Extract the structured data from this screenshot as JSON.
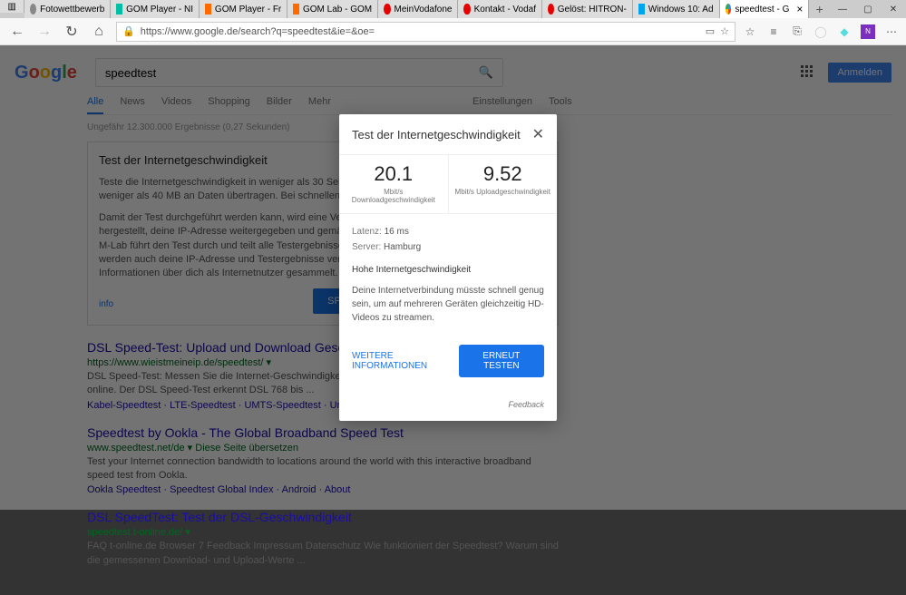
{
  "browser": {
    "tabs": [
      {
        "label": "Fotowettbewerb",
        "color": "#888"
      },
      {
        "label": "GOM Player - NI",
        "color": "#00bfa5"
      },
      {
        "label": "GOM Player - Fr",
        "color": "#ff6a00"
      },
      {
        "label": "GOM Lab - GOM",
        "color": "#ff6a00"
      },
      {
        "label": "MeinVodafone",
        "color": "#e60000"
      },
      {
        "label": "Kontakt - Vodaf",
        "color": "#e60000"
      },
      {
        "label": "Gelöst: HITRON-",
        "color": "#e60000"
      },
      {
        "label": "Windows 10: Ad",
        "color": "#00a4ef"
      },
      {
        "label": "speedtest - G",
        "color": "#4285f4",
        "active": true
      }
    ],
    "url": "https://www.google.de/search?q=speedtest&ie=&oe="
  },
  "google": {
    "query": "speedtest",
    "signin": "Anmelden",
    "tabs": [
      "Alle",
      "News",
      "Videos",
      "Shopping",
      "Bilder",
      "Mehr"
    ],
    "tools_label": "Einstellungen",
    "tools_label2": "Tools",
    "stats": "Ungefähr 12.300.000 Ergebnisse (0,27 Sekunden)"
  },
  "speedcard": {
    "title": "Test der Internetgeschwindigkeit",
    "p1": "Teste die Internetgeschwindigkeit in weniger als 30 Sekunden. Bei diesem Test werden in der Regel weniger als 40 MB an Daten übertragen. Bei schnellen Verbindungen kann es jedoch mehr sein.",
    "p2": "Damit der Test durchgeführt werden kann, wird eine Verbindung zu Measurement Lab (M-Lab) hergestellt, deine IP-Adresse weitergegeben und gemäß der privacy policy des Anbieters verarbeitet. M-Lab führt den Test durch und teilt alle Testergebnisse öffentlich, um die Internetforschung. Dabei werden auch deine IP-Adresse und Testergebnisse veröffentlicht. Es werden aber keine anderen Informationen über dich als Internetnutzer gesammelt.",
    "button": "SPEED TEST",
    "info": "info"
  },
  "results": [
    {
      "title": "DSL Speed-Test: Upload und Download Geschwindigkeit",
      "url": "https://www.wieistmeineip.de/speedtest/ ▾",
      "snippet": "DSL Speed-Test: Messen Sie die Internet-Geschwindigkeit (Download und Upload) Ihrer DSL-Verbindung online. Der DSL Speed-Test erkennt DSL 768 bis ...",
      "links": "Kabel-Speedtest · LTE-Speedtest · UMTS-Speedtest · Unitymedia"
    },
    {
      "title": "Speedtest by Ookla - The Global Broadband Speed Test",
      "url": "www.speedtest.net/de ▾ Diese Seite übersetzen",
      "snippet": "Test your Internet connection bandwidth to locations around the world with this interactive broadband speed test from Ookla.",
      "links": "Ookla Speedtest · Speedtest Global Index · Android · About"
    },
    {
      "title": "DSL SpeedTest: Test der DSL-Geschwindigkeit",
      "url": "speedtest.t-online.de/ ▾",
      "snippet": "FAQ t-online.de Browser 7 Feedback Impressum Datenschutz Wie funktioniert der Speedtest? Warum sind die gemessenen Download- und Upload-Werte ...",
      "links": ""
    }
  ],
  "modal": {
    "title": "Test der Internetgeschwindigkeit",
    "download_value": "20.1",
    "download_label": "Mbit/s Downloadgeschwindigkeit",
    "upload_value": "9.52",
    "upload_label": "Mbit/s Uploadgeschwindigkeit",
    "latency_label": "Latenz:",
    "latency_value": "16 ms",
    "server_label": "Server:",
    "server_value": "Hamburg",
    "headline": "Hohe Internetgeschwindigkeit",
    "description": "Deine Internetverbindung müsste schnell genug sein, um auf mehreren Geräten gleichzeitig HD-Videos zu streamen.",
    "more_info": "WEITERE INFORMATIONEN",
    "retest": "ERNEUT TESTEN",
    "feedback": "Feedback"
  }
}
